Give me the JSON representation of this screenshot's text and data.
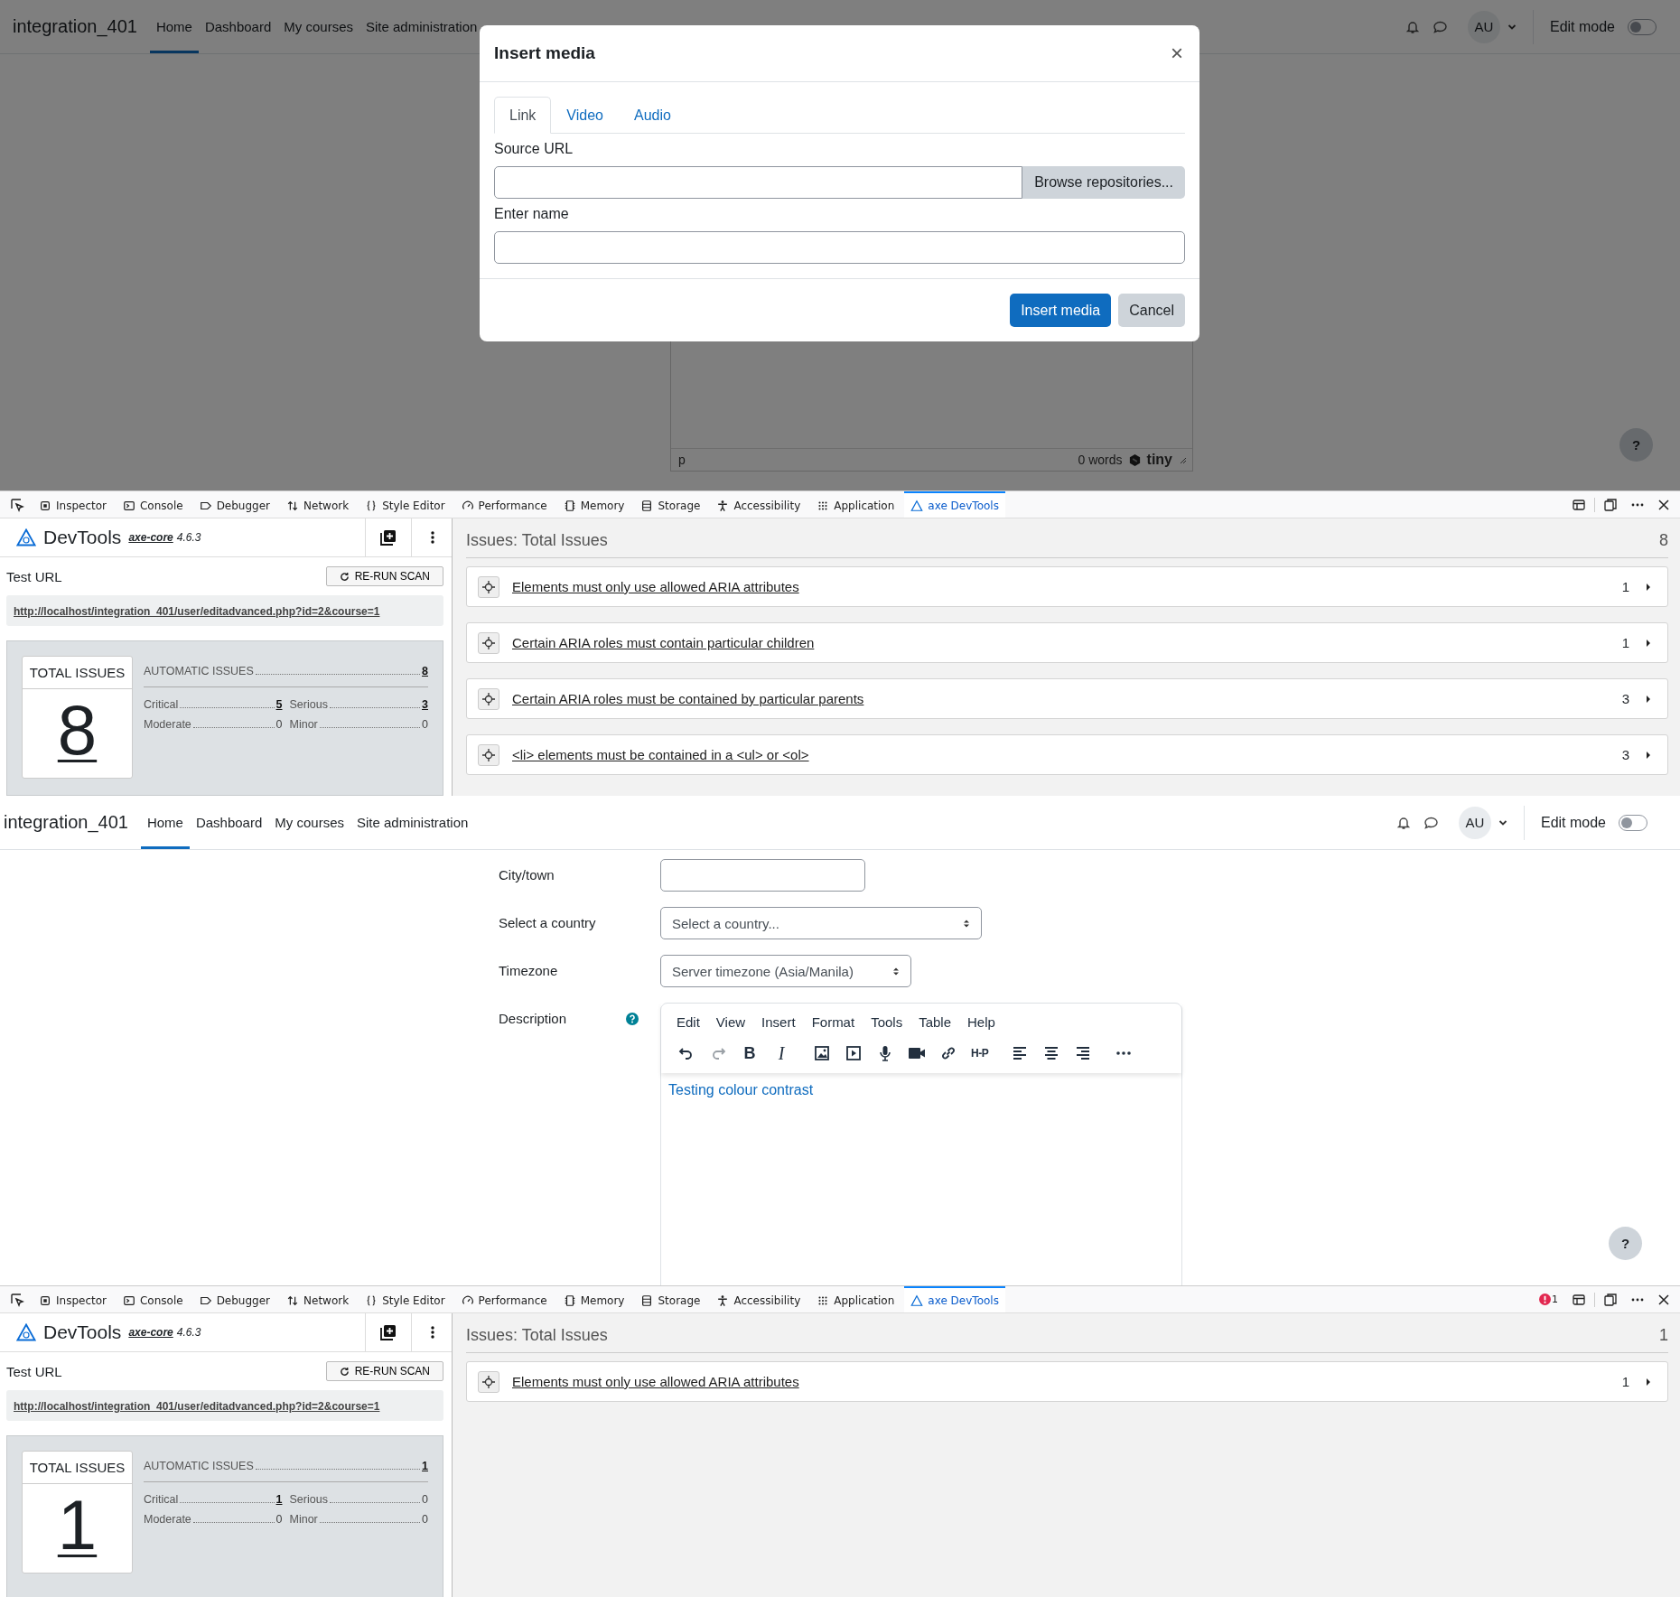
{
  "shots": [
    {
      "page": {
        "kind": "modal",
        "navbar": {
          "site": "integration_401",
          "links": [
            {
              "label": "Home",
              "selected": true
            },
            {
              "label": "Dashboard",
              "selected": false
            },
            {
              "label": "My courses",
              "selected": false
            },
            {
              "label": "Site administration",
              "selected": false
            }
          ],
          "avatar": "AU",
          "edit_mode": {
            "label": "Edit mode",
            "on": false
          }
        },
        "editor_status": {
          "path": "p",
          "words": "0 words",
          "brand": "tiny"
        },
        "modal": {
          "title": "Insert media",
          "close": "×",
          "tabs": [
            {
              "label": "Link",
              "selected": true
            },
            {
              "label": "Video",
              "selected": false
            },
            {
              "label": "Audio",
              "selected": false
            }
          ],
          "fields": [
            {
              "label": "Source URL",
              "button": "Browse repositories..."
            },
            {
              "label": "Enter name"
            }
          ],
          "actions": [
            {
              "label": "Insert media",
              "kind": "primary"
            },
            {
              "label": "Cancel",
              "kind": "secondary"
            }
          ]
        },
        "help": "?"
      },
      "devtools": {
        "tabs": [
          {
            "label": "Inspector",
            "selected": false
          },
          {
            "label": "Console",
            "selected": false
          },
          {
            "label": "Debugger",
            "selected": false
          },
          {
            "label": "Network",
            "selected": false
          },
          {
            "label": "Style Editor",
            "selected": false
          },
          {
            "label": "Performance",
            "selected": false
          },
          {
            "label": "Memory",
            "selected": false
          },
          {
            "label": "Storage",
            "selected": false
          },
          {
            "label": "Accessibility",
            "selected": false
          },
          {
            "label": "Application",
            "selected": false
          },
          {
            "label": "axe DevTools",
            "selected": true
          }
        ],
        "panel": {
          "brand": "DevTools",
          "engine": "axe-core",
          "version": "4.6.3",
          "test_url_label": "Test URL",
          "rerun": "RE-RUN SCAN",
          "url": "http://localhost/integration_401/user/editadvanced.php?id=2&course=1",
          "summary": {
            "title": "TOTAL ISSUES",
            "total": "8",
            "automatic": {
              "label": "AUTOMATIC ISSUES",
              "value": "8"
            },
            "stats": [
              {
                "label": "Critical",
                "value": "5",
                "linked": true
              },
              {
                "label": "Serious",
                "value": "3",
                "linked": true
              },
              {
                "label": "Moderate",
                "value": "0",
                "linked": false
              },
              {
                "label": "Minor",
                "value": "0",
                "linked": false
              }
            ]
          }
        },
        "issues": {
          "title": "Issues: Total Issues",
          "count": "8",
          "items": [
            {
              "title": "Elements must only use allowed ARIA attributes",
              "count": "1"
            },
            {
              "title": "Certain ARIA roles must contain particular children",
              "count": "1"
            },
            {
              "title": "Certain ARIA roles must be contained by particular parents",
              "count": "3"
            },
            {
              "title": "<li> elements must be contained in a <ul> or <ol>",
              "count": "3"
            }
          ]
        }
      }
    },
    {
      "page": {
        "kind": "form",
        "navbar": {
          "site": "integration_401",
          "links": [
            {
              "label": "Home",
              "selected": true
            },
            {
              "label": "Dashboard",
              "selected": false
            },
            {
              "label": "My courses",
              "selected": false
            },
            {
              "label": "Site administration",
              "selected": false
            }
          ],
          "avatar": "AU",
          "edit_mode": {
            "label": "Edit mode",
            "on": false
          }
        },
        "rows": [
          {
            "label": "City/town",
            "kind": "text"
          },
          {
            "label": "Select a country",
            "kind": "select",
            "value": "Select a country..."
          },
          {
            "label": "Timezone",
            "kind": "select",
            "value": "Server timezone (Asia/Manila)"
          },
          {
            "label": "Description",
            "kind": "editor",
            "menu": [
              "Edit",
              "View",
              "Insert",
              "Format",
              "Tools",
              "Table",
              "Help"
            ],
            "toolbar": [
              {
                "kind": "undo",
                "disabled": false
              },
              {
                "kind": "redo",
                "disabled": true
              },
              {
                "kind": "bold",
                "label": "B",
                "disabled": false
              },
              {
                "kind": "italic",
                "label": "I",
                "disabled": false
              },
              {
                "kind": "image",
                "disabled": false
              },
              {
                "kind": "media",
                "disabled": false
              },
              {
                "kind": "mic",
                "disabled": false
              },
              {
                "kind": "video",
                "disabled": false
              },
              {
                "kind": "link",
                "disabled": false
              },
              {
                "kind": "h5p",
                "label": "H-P",
                "disabled": false
              },
              {
                "kind": "align-left",
                "disabled": false
              },
              {
                "kind": "align-center",
                "disabled": false
              },
              {
                "kind": "align-right",
                "disabled": false
              },
              {
                "kind": "more",
                "disabled": false
              }
            ],
            "content": "Testing colour contrast"
          }
        ],
        "help": "?"
      },
      "devtools": {
        "tabs": [
          {
            "label": "Inspector",
            "selected": false
          },
          {
            "label": "Console",
            "selected": false
          },
          {
            "label": "Debugger",
            "selected": false
          },
          {
            "label": "Network",
            "selected": false
          },
          {
            "label": "Style Editor",
            "selected": false
          },
          {
            "label": "Performance",
            "selected": false
          },
          {
            "label": "Memory",
            "selected": false
          },
          {
            "label": "Storage",
            "selected": false
          },
          {
            "label": "Accessibility",
            "selected": false
          },
          {
            "label": "Application",
            "selected": false
          },
          {
            "label": "axe DevTools",
            "selected": true
          }
        ],
        "error_count": "1",
        "panel": {
          "brand": "DevTools",
          "engine": "axe-core",
          "version": "4.6.3",
          "test_url_label": "Test URL",
          "rerun": "RE-RUN SCAN",
          "url": "http://localhost/integration_401/user/editadvanced.php?id=2&course=1",
          "summary": {
            "title": "TOTAL ISSUES",
            "total": "1",
            "automatic": {
              "label": "AUTOMATIC ISSUES",
              "value": "1"
            },
            "stats": [
              {
                "label": "Critical",
                "value": "1",
                "linked": true
              },
              {
                "label": "Serious",
                "value": "0",
                "linked": false
              },
              {
                "label": "Moderate",
                "value": "0",
                "linked": false
              },
              {
                "label": "Minor",
                "value": "0",
                "linked": false
              }
            ]
          }
        },
        "issues": {
          "title": "Issues: Total Issues",
          "count": "1",
          "items": [
            {
              "title": "Elements must only use allowed ARIA attributes",
              "count": "1"
            }
          ]
        }
      }
    }
  ]
}
